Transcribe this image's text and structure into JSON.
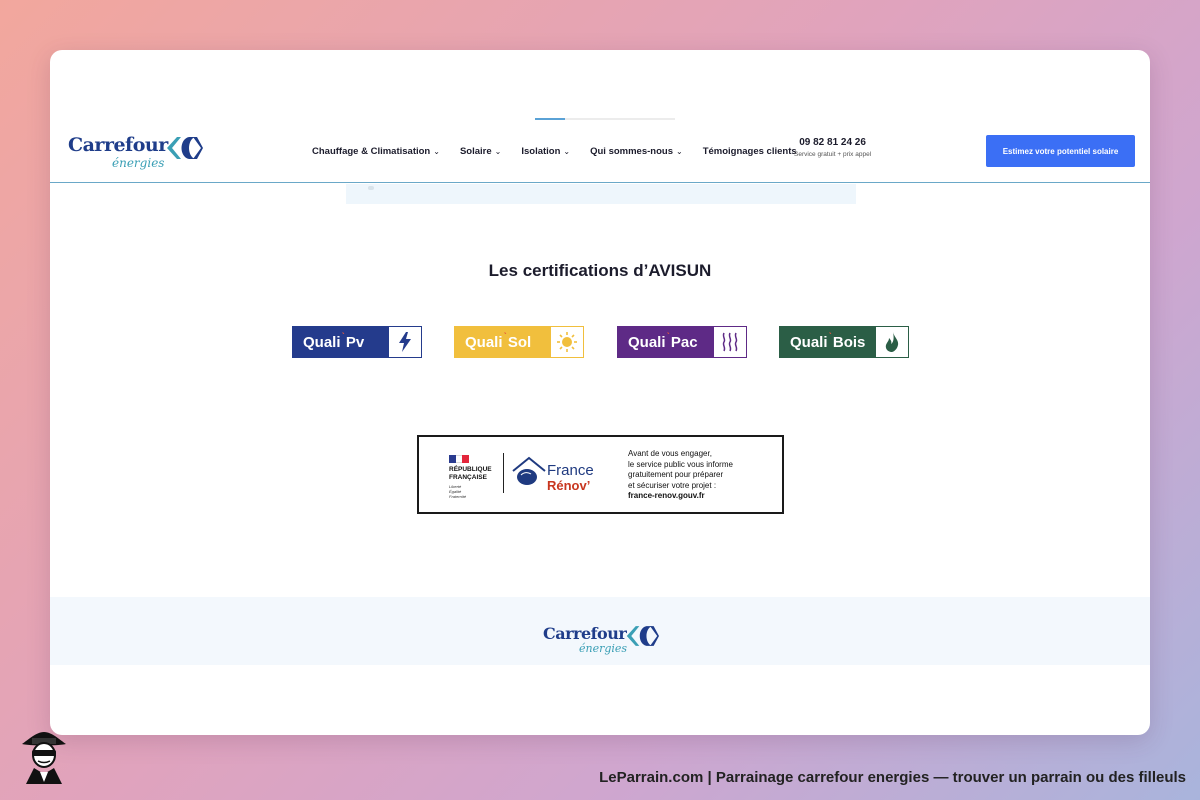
{
  "header": {
    "logo": {
      "word": "Carrefour",
      "sub": "énergies",
      "icon": "carrefour-logo-icon"
    },
    "nav": [
      {
        "label": "Chauffage & Climatisation",
        "dropdown": true
      },
      {
        "label": "Solaire",
        "dropdown": true
      },
      {
        "label": "Isolation",
        "dropdown": true
      },
      {
        "label": "Qui sommes-nous",
        "dropdown": true
      },
      {
        "label": "Témoignages clients",
        "dropdown": false
      }
    ],
    "phone": {
      "number": "09 82 81 24 26",
      "note": "Service gratuit + prix appel"
    },
    "cta_label": "Estimez votre potentiel solaire"
  },
  "certifications": {
    "title": "Les certifications d’AVISUN",
    "badges": [
      {
        "prefix": "Quali",
        "suffix": "Pv",
        "icon": "lightning-icon",
        "color": "#243b8c"
      },
      {
        "prefix": "Quali",
        "suffix": "Sol",
        "icon": "sun-icon",
        "color": "#f1bf3d"
      },
      {
        "prefix": "Quali",
        "suffix": "Pac",
        "icon": "heat-waves-icon",
        "color": "#5e2a86"
      },
      {
        "prefix": "Quali",
        "suffix": "Bois",
        "icon": "flame-icon",
        "color": "#2b5e46"
      }
    ]
  },
  "france_renov": {
    "republique": [
      "RÉPUBLIQUE",
      "FRANÇAISE"
    ],
    "motto": [
      "Liberté",
      "Égalité",
      "Fraternité"
    ],
    "brand_a": "France",
    "brand_b": "Rénov’",
    "text": [
      "Avant de vous engager,",
      "le service public vous informe",
      "gratuitement pour préparer",
      "et sécuriser votre projet :"
    ],
    "url": "france-renov.gouv.fr"
  },
  "footer": {
    "logo_word": "Carrefour",
    "logo_sub": "énergies"
  },
  "caption": "LeParrain.com | Parrainage carrefour energies — trouver un parrain ou des filleuls",
  "colors": {
    "accent": "#3b6ff5",
    "brand_blue": "#1f3d8a",
    "brand_teal": "#3a9fb5"
  }
}
